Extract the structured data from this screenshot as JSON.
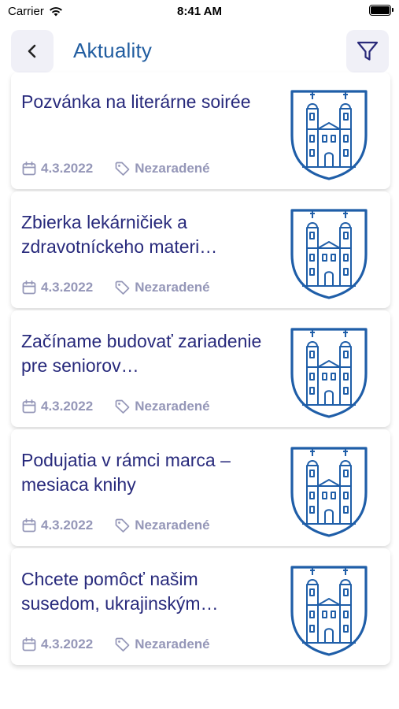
{
  "status_bar": {
    "carrier": "Carrier",
    "time": "8:41 AM"
  },
  "header": {
    "title": "Aktuality",
    "back_icon": "chevron-left-icon",
    "filter_icon": "filter-icon"
  },
  "colors": {
    "title": "#215da0",
    "card_title": "#282a7c",
    "meta": "#9597b8",
    "crest": "#1f5ea8",
    "button_bg": "#f0f0f7"
  },
  "articles": [
    {
      "title": "Pozvánka na literárne soirée",
      "date": "4.3.2022",
      "category": "Nezaradené"
    },
    {
      "title": "Zbierka lekárničiek a zdravotníckeho materi…",
      "date": "4.3.2022",
      "category": "Nezaradené"
    },
    {
      "title": "Začíname budovať zariadenie pre seniorov…",
      "date": "4.3.2022",
      "category": "Nezaradené"
    },
    {
      "title": "Podujatia v rámci marca – mesiaca knihy",
      "date": "4.3.2022",
      "category": "Nezaradené"
    },
    {
      "title": "Chcete pomôcť našim susedom, ukrajinským…",
      "date": "4.3.2022",
      "category": "Nezaradené"
    }
  ]
}
